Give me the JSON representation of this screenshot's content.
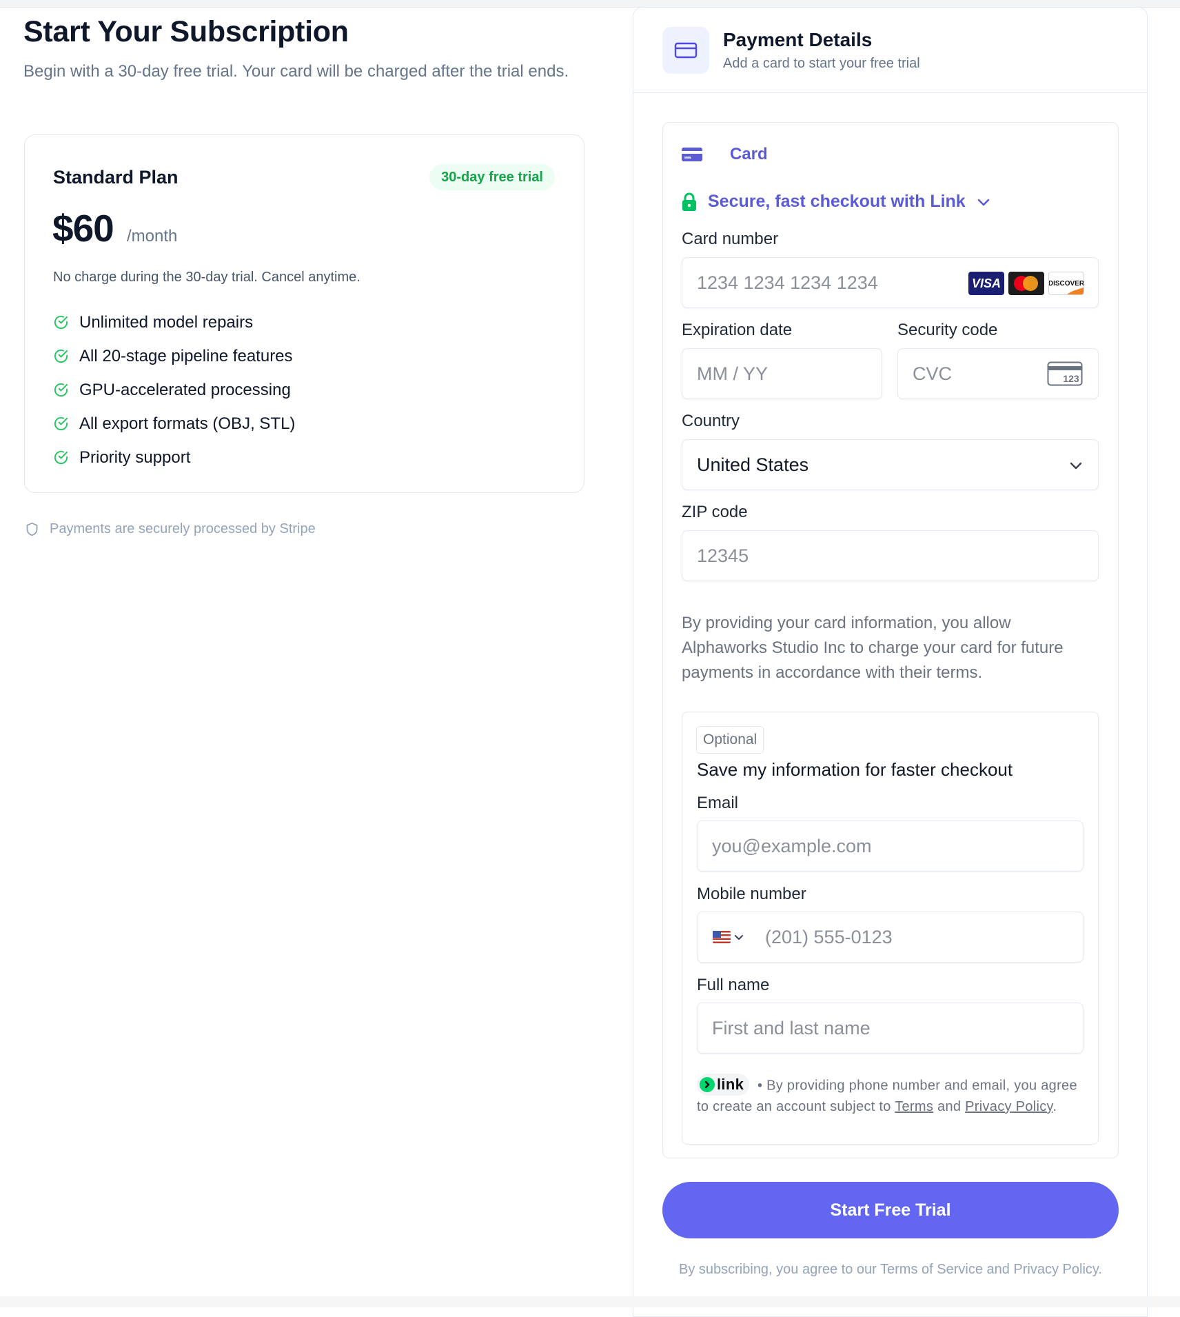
{
  "page": {
    "title": "Start Your Subscription",
    "subtitle": "Begin with a 30-day free trial. Your card will be charged after the trial ends."
  },
  "plan": {
    "name": "Standard Plan",
    "badge": "30-day free trial",
    "price": "$60",
    "period": "/month",
    "note": "No charge during the 30-day trial. Cancel anytime.",
    "features": [
      "Unlimited model repairs",
      "All 20-stage pipeline features",
      "GPU-accelerated processing",
      "All export formats (OBJ, STL)",
      "Priority support"
    ]
  },
  "security_note": "Payments are securely processed by Stripe",
  "payment": {
    "title": "Payment Details",
    "subtitle": "Add a card to start your free trial",
    "method_tab": "Card",
    "link_checkout": "Secure, fast checkout with Link",
    "card_number": {
      "label": "Card number",
      "placeholder": "1234 1234 1234 1234",
      "brands": [
        "VISA",
        "mastercard",
        "DISCOVER"
      ]
    },
    "expiration": {
      "label": "Expiration date",
      "placeholder": "MM / YY"
    },
    "security_code": {
      "label": "Security code",
      "placeholder": "CVC",
      "icon_text": "123"
    },
    "country": {
      "label": "Country",
      "value": "United States"
    },
    "zip": {
      "label": "ZIP code",
      "placeholder": "12345"
    },
    "consent": "By providing your card information, you allow Alphaworks Studio Inc to charge your card for future payments in accordance with their terms.",
    "link_save": {
      "badge": "Optional",
      "title": "Save my information for faster checkout",
      "email": {
        "label": "Email",
        "placeholder": "you@example.com"
      },
      "mobile": {
        "label": "Mobile number",
        "placeholder": "(201) 555-0123"
      },
      "full_name": {
        "label": "Full name",
        "placeholder": "First and last name"
      },
      "legal": {
        "logo_text": "link",
        "prefix": "• By providing phone number and email, you agree to create an account subject to",
        "terms": "Terms",
        "and": "and",
        "privacy": "Privacy Policy",
        "suffix": "."
      }
    },
    "submit_label": "Start Free Trial",
    "footer": "By subscribing, you agree to our Terms of Service and Privacy Policy."
  },
  "colors": {
    "accent": "#6366f1",
    "link_purple": "#5b5bd6",
    "success_green": "#16a34a",
    "link_green": "#00d66f"
  }
}
